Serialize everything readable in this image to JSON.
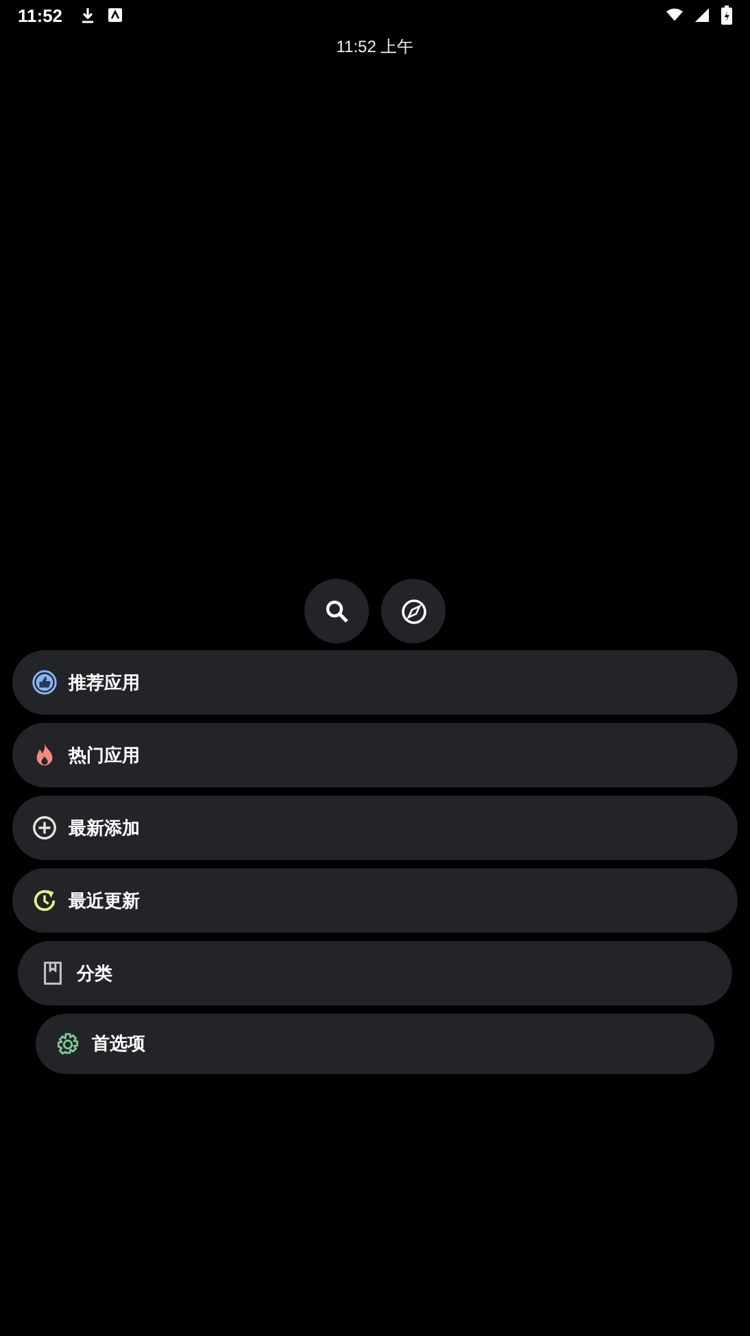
{
  "status_bar": {
    "time": "11:52"
  },
  "lock_clock": "11:52 上午",
  "menu": [
    {
      "label": "推荐应用",
      "kind": "thumb",
      "color": "#8ab4f8"
    },
    {
      "label": "热门应用",
      "kind": "fire",
      "color": "#f28b82"
    },
    {
      "label": "最新添加",
      "kind": "plus",
      "color": "#e8e3df"
    },
    {
      "label": "最近更新",
      "kind": "refresh",
      "color": "#e6f08a"
    },
    {
      "label": "分类",
      "kind": "book",
      "color": "#c4c7c5"
    },
    {
      "label": "首选项",
      "kind": "gear",
      "color": "#81c995"
    }
  ]
}
